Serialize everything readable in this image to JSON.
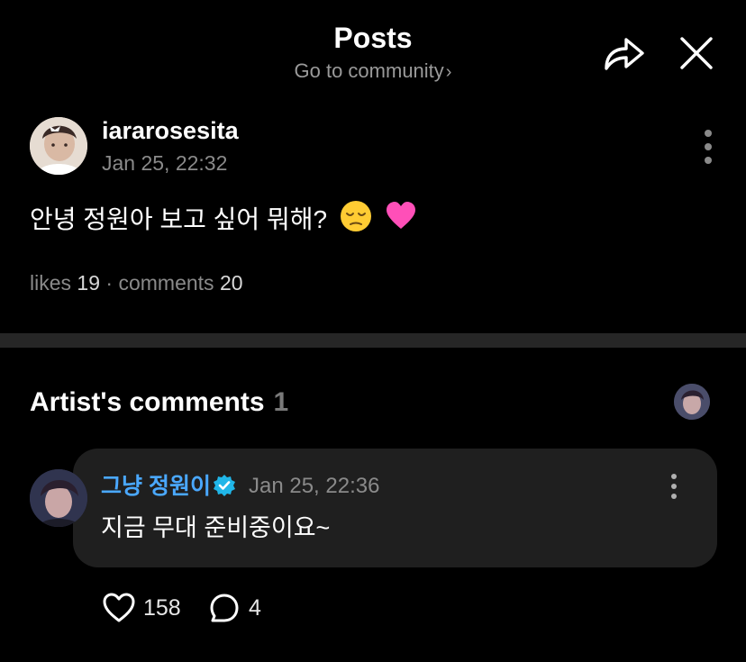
{
  "header": {
    "title": "Posts",
    "subtitle": "Go to community",
    "subtitle_chevron": "›",
    "share_icon": "share-icon",
    "close_icon": "close-icon"
  },
  "post": {
    "author": "iararosesita",
    "timestamp": "Jan 25, 22:32",
    "body": "안녕 정원아 보고 싶어 뭐해?",
    "emojis": [
      "pensive-face",
      "pink-heart"
    ],
    "stats": {
      "likes_label": "likes",
      "likes_count": "19",
      "separator": "·",
      "comments_label": "comments",
      "comments_count": "20"
    }
  },
  "artist_comments": {
    "title": "Artist's comments",
    "count": "1",
    "comment": {
      "author": "그냥 정원이",
      "verified": true,
      "timestamp": "Jan 25, 22:36",
      "text": "지금 무대 준비중이요~",
      "likes": "158",
      "replies": "4"
    }
  },
  "colors": {
    "background": "#000000",
    "accent_name": "#4aa8ff",
    "verified_badge": "#20b6e8",
    "bubble": "#1f1f1f",
    "muted_text": "#8a8a8a",
    "divider": "#262626"
  }
}
